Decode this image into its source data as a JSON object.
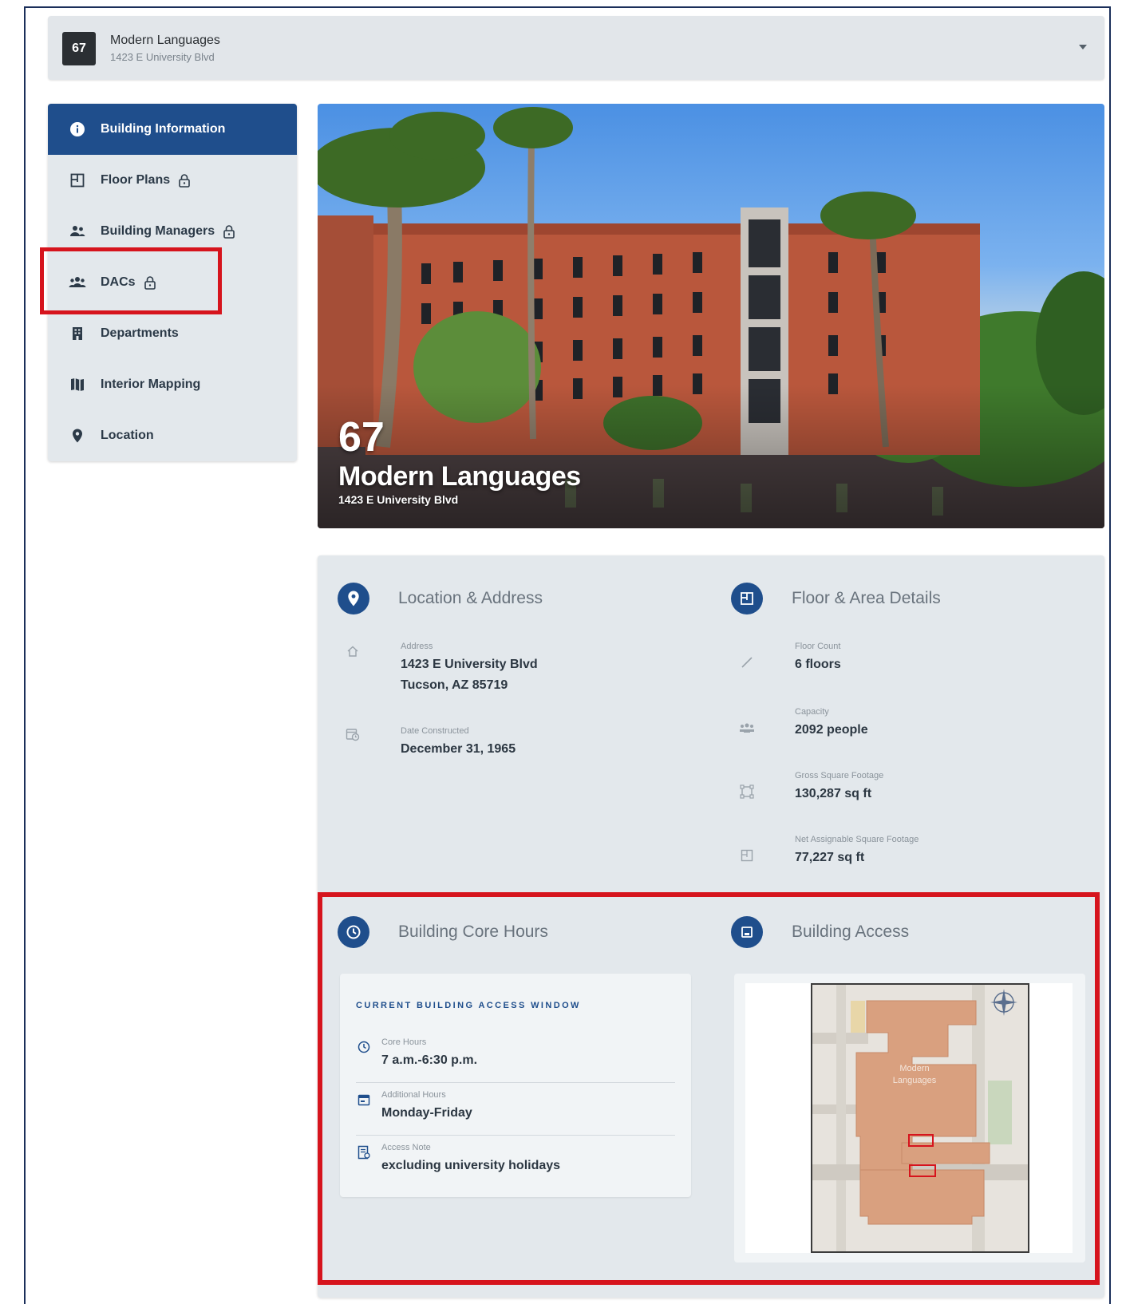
{
  "selector": {
    "number": "67",
    "name": "Modern Languages",
    "address": "1423 E University Blvd"
  },
  "sidebar": {
    "items": [
      {
        "label": "Building Information",
        "active": true,
        "icon": "info-icon",
        "locked": false
      },
      {
        "label": "Floor Plans",
        "active": false,
        "icon": "floor-plan-icon",
        "locked": true
      },
      {
        "label": "Building Managers",
        "active": false,
        "icon": "managers-icon",
        "locked": true
      },
      {
        "label": "DACs",
        "active": false,
        "icon": "group-icon",
        "locked": true
      },
      {
        "label": "Departments",
        "active": false,
        "icon": "building-icon",
        "locked": false
      },
      {
        "label": "Interior Mapping",
        "active": false,
        "icon": "map-icon",
        "locked": false
      },
      {
        "label": "Location",
        "active": false,
        "icon": "pin-icon",
        "locked": false
      }
    ]
  },
  "hero": {
    "number": "67",
    "name": "Modern Languages",
    "address": "1423 E University Blvd"
  },
  "location": {
    "title": "Location & Address",
    "address_label": "Address",
    "address_line1": "1423 E University Blvd",
    "address_line2": "Tucson, AZ 85719",
    "date_label": "Date Constructed",
    "date_value": "December 31, 1965"
  },
  "floor": {
    "title": "Floor & Area Details",
    "fields": [
      {
        "label": "Floor Count",
        "value": "6 floors"
      },
      {
        "label": "Capacity",
        "value": "2092 people"
      },
      {
        "label": "Gross Square Footage",
        "value": "130,287 sq ft"
      },
      {
        "label": "Net Assignable Square Footage",
        "value": "77,227 sq ft"
      }
    ]
  },
  "hours": {
    "title": "Building Core Hours",
    "heading": "CURRENT BUILDING ACCESS WINDOW",
    "rows": [
      {
        "label": "Core Hours",
        "value": "7 a.m.-6:30 p.m.",
        "icon": "clock-icon"
      },
      {
        "label": "Additional Hours",
        "value": "Monday-Friday",
        "icon": "calendar-icon"
      },
      {
        "label": "Access Note",
        "value": "excluding university holidays",
        "icon": "note-icon"
      }
    ]
  },
  "access": {
    "title": "Building Access",
    "map_label_line1": "Modern",
    "map_label_line2": "Languages"
  },
  "colors": {
    "primary": "#1f4e8c",
    "highlight": "#d6141d",
    "card_bg": "#e3e8ec",
    "building_fill": "#d9a07f"
  }
}
